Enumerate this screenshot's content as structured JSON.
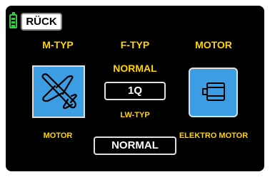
{
  "back_button": "RÜCK",
  "columns": {
    "m_typ": {
      "header": "M-TYP",
      "label": "MOTOR",
      "icon": "airplane-icon"
    },
    "f_typ": {
      "header": "F-TYP",
      "value_label": "NORMAL",
      "value": "1Q",
      "sub_header": "LW-TYP",
      "sub_value": "NORMAL"
    },
    "motor": {
      "header": "MOTOR",
      "label": "ELEKTRO MOTOR",
      "icon": "electric-motor-icon"
    }
  },
  "colors": {
    "accent": "#ffd400",
    "tile": "#3c9de3",
    "battery": "#2ecc40"
  }
}
